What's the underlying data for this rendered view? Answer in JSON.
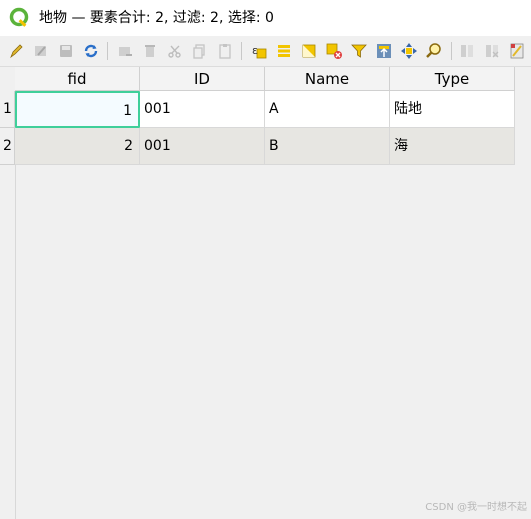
{
  "window": {
    "title": "地物 — 要素合计: 2, 过滤: 2, 选择: 0"
  },
  "toolbar": {
    "buttons": [
      {
        "name": "toggle-editing-icon",
        "enabled": true
      },
      {
        "name": "multi-edit-icon",
        "enabled": false
      },
      {
        "name": "save-edits-icon",
        "enabled": false
      },
      {
        "name": "reload-icon",
        "enabled": true
      },
      {
        "name": "add-feature-icon",
        "enabled": false
      },
      {
        "name": "delete-feature-icon",
        "enabled": false
      },
      {
        "name": "cut-icon",
        "enabled": false
      },
      {
        "name": "copy-icon",
        "enabled": false
      },
      {
        "name": "paste-icon",
        "enabled": false
      },
      {
        "name": "select-by-expression-icon",
        "enabled": true
      },
      {
        "name": "select-all-icon",
        "enabled": true
      },
      {
        "name": "invert-selection-icon",
        "enabled": true
      },
      {
        "name": "deselect-all-icon",
        "enabled": true
      },
      {
        "name": "filter-icon",
        "enabled": true
      },
      {
        "name": "move-selection-to-top-icon",
        "enabled": true
      },
      {
        "name": "pan-to-selected-icon",
        "enabled": true
      },
      {
        "name": "zoom-to-selected-icon",
        "enabled": true
      },
      {
        "name": "new-field-icon",
        "enabled": false
      },
      {
        "name": "delete-field-icon",
        "enabled": false
      },
      {
        "name": "field-calculator-icon",
        "enabled": true
      }
    ]
  },
  "table": {
    "columns": [
      "fid",
      "ID",
      "Name",
      "Type"
    ],
    "rows": [
      {
        "num": "1",
        "fid": "1",
        "ID": "001",
        "Name": "A",
        "Type": "陆地"
      },
      {
        "num": "2",
        "fid": "2",
        "ID": "001",
        "Name": "B",
        "Type": "海"
      }
    ]
  },
  "watermark": "CSDN @我一时想不起",
  "colors": {
    "accent_green": "#3fcf9a",
    "qgis_green": "#5bb33b",
    "row_alt": "#e7e6e2"
  }
}
